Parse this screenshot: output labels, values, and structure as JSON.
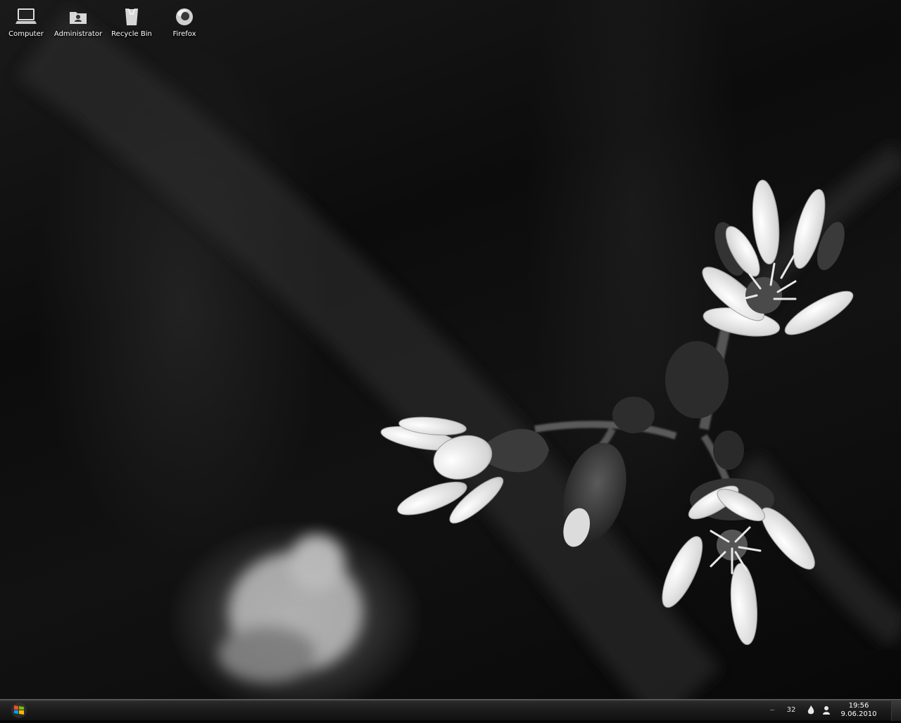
{
  "desktop": {
    "icons": [
      {
        "label": "Computer",
        "icon": "computer-icon"
      },
      {
        "label": "Administrator",
        "icon": "user-folder-icon"
      },
      {
        "label": "Recycle Bin",
        "icon": "recycle-bin-icon"
      },
      {
        "label": "Firefox",
        "icon": "firefox-icon"
      }
    ],
    "wallpaper": "monochrome-flower-macro"
  },
  "taskbar": {
    "start_icon": "windows-logo-icon",
    "tray": {
      "counter": "32",
      "flame_icon": "flame-icon",
      "user_icon": "user-icon"
    },
    "clock": {
      "time": "19:56",
      "date": "9.06.2010"
    }
  },
  "colors": {
    "taskbar_top": "#4a4a4a",
    "taskbar_bottom": "#111111",
    "label_text": "#ffffff"
  }
}
